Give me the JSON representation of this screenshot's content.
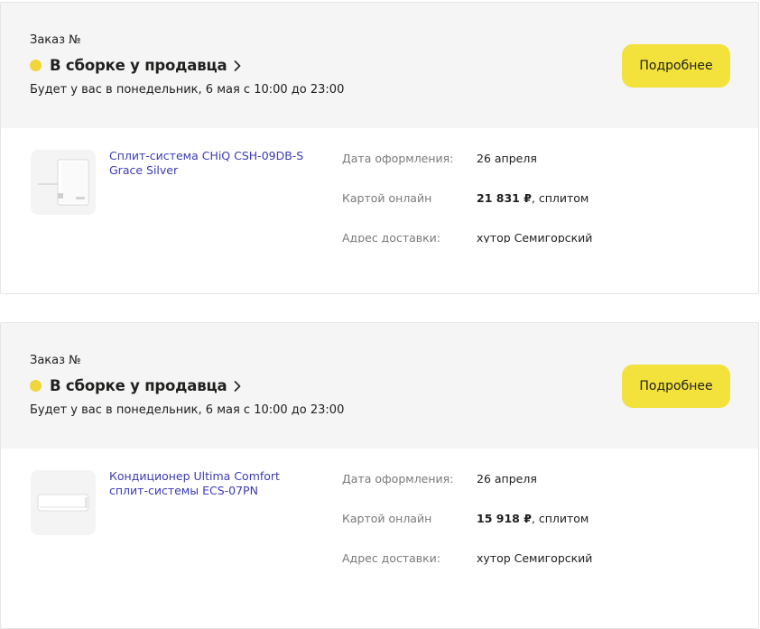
{
  "orders": [
    {
      "order_label": "Заказ №",
      "status": "В сборке у продавца",
      "delivery": "Будет у вас в понедельник, 6 мая с 10:00 до 23:00",
      "details_button": "Подробнее",
      "product_name": "Сплит-система CHiQ CSH-09DB-S Grace Silver",
      "date_label": "Дата оформления:",
      "date_value": "26 апреля",
      "payment_label": "Картой онлайн",
      "payment_amount": "21 831 ₽",
      "payment_suffix": ", сплитом",
      "address_label": "Адрес доставки:",
      "address_value": "хутор Семигорский"
    },
    {
      "order_label": "Заказ №",
      "status": "В сборке у продавца",
      "delivery": "Будет у вас в понедельник, 6 мая с 10:00 до 23:00",
      "details_button": "Подробнее",
      "product_name": "Кондиционер Ultima Comfort сплит-системы ECS-07PN",
      "date_label": "Дата оформления:",
      "date_value": "26 апреля",
      "payment_label": "Картой онлайн",
      "payment_amount": "15 918 ₽",
      "payment_suffix": ", сплитом",
      "address_label": "Адрес доставки:",
      "address_value": "хутор Семигорский"
    }
  ],
  "colors": {
    "status_dot": "#f0d63a",
    "button": "#f2e23b",
    "link": "#3b3bb8",
    "header_bg": "#f5f5f5"
  },
  "icons": {
    "status_chevron": "chevron-right-icon",
    "product_1": "split-system-indoor-unit-image",
    "product_2": "air-conditioner-image"
  }
}
